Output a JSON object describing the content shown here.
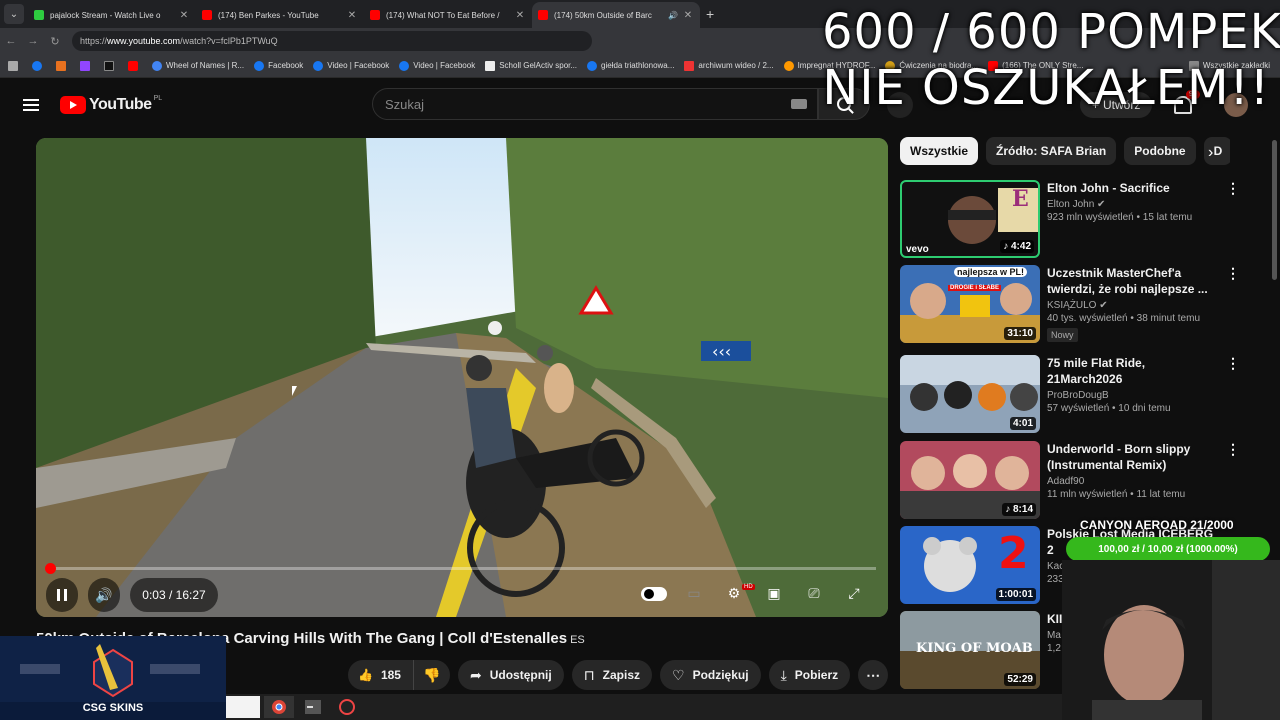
{
  "browser": {
    "tabs": [
      {
        "title": "pajalock Stream - Watch Live o",
        "color": "#2ecc40"
      },
      {
        "title": "(174) Ben Parkes - YouTube",
        "color": "#ff0000"
      },
      {
        "title": "(174) What NOT To Eat Before /",
        "color": "#ff0000"
      },
      {
        "title": "(174) 50km Outside of Barc",
        "color": "#ff0000"
      }
    ],
    "new_tab": "+",
    "url_prefix": "https://",
    "url_host": "www.youtube.com",
    "url_path": "/watch?v=fclPb1PTWuQ",
    "bookmarks": [
      "Wheel of Names | R...",
      "Facebook",
      "Video | Facebook",
      "Video | Facebook",
      "Scholl GelActiv spor...",
      "giełda triathlonowa...",
      "archiwum wideo / 2...",
      "Impregnat HYDROF...",
      "Ćwiczenia na biodra...",
      "(166) The ONLY Stre...",
      "Wszystkie zakładki"
    ]
  },
  "header": {
    "logo_text": "YouTube",
    "region": "PL",
    "search_placeholder": "Szukaj",
    "create_label": "Utwórz",
    "notif_count": "9+"
  },
  "overlay": {
    "line1": "600 / 600 POMPEK",
    "line2": "NIE OSZUKAŁEM!!"
  },
  "player": {
    "time": "0:03 / 16:27",
    "progress": 0.003
  },
  "video": {
    "title": "50km Outside of Barcelona Carving Hills With The Gang | Coll d'Estenalles",
    "lang": "ES",
    "likes": "185",
    "share": "Udostępnij",
    "save": "Zapisz",
    "thanks": "Podziękuj",
    "download": "Pobierz"
  },
  "chips": [
    "Wszystkie",
    "Źródło: SAFA Brian",
    "Podobne",
    "D"
  ],
  "recommendations": [
    {
      "title": "Elton John - Sacrifice",
      "channel": "Elton John",
      "meta": "923 mln wyświetleń • 15 lat temu",
      "duration": "4:42",
      "color": "#9b2d7a",
      "new": ""
    },
    {
      "title": "Uczestnik MasterChef'a twierdzi, że robi najlepsze ...",
      "channel": "KSIĄŻULO",
      "meta": "40 tys. wyświetleń • 38 minut temu",
      "duration": "31:10",
      "color": "#3b6fb6",
      "new": "Nowy"
    },
    {
      "title": "75 mile Flat Ride, 21March2026",
      "channel": "ProBroDougB",
      "meta": "57 wyświetleń • 10 dni temu",
      "duration": "4:01",
      "color": "#7a8aa0",
      "new": ""
    },
    {
      "title": "Underworld - Born slippy (Instrumental Remix)",
      "channel": "Adadf90",
      "meta": "11 mln wyświetleń • 11 lat temu",
      "duration": "8:14",
      "color": "#b24a5e",
      "new": ""
    },
    {
      "title": "Polskie Lost Media ICEBERG 2",
      "channel": "Kac",
      "meta": "233",
      "duration": "1:00:01",
      "color": "#2a66c8",
      "new": ""
    },
    {
      "title": "KII",
      "channel": "Ma",
      "meta": "1,2",
      "duration": "52:29",
      "color": "#6b5a3a",
      "new": ""
    }
  ],
  "thumb_texts": {
    "elton": "E",
    "vevo": "vevo",
    "ks_banner": "najlepsza w PL!",
    "ks_sub": "DROGIE i SŁABE",
    "iceberg": "2",
    "moab": "KING OF MOAB"
  },
  "stream": {
    "canyon": "CANYON AEROAD 21/2000",
    "donate": "100,00 zł / 10,00 zł (1000.00%)",
    "csg": "CSG SKINS"
  }
}
